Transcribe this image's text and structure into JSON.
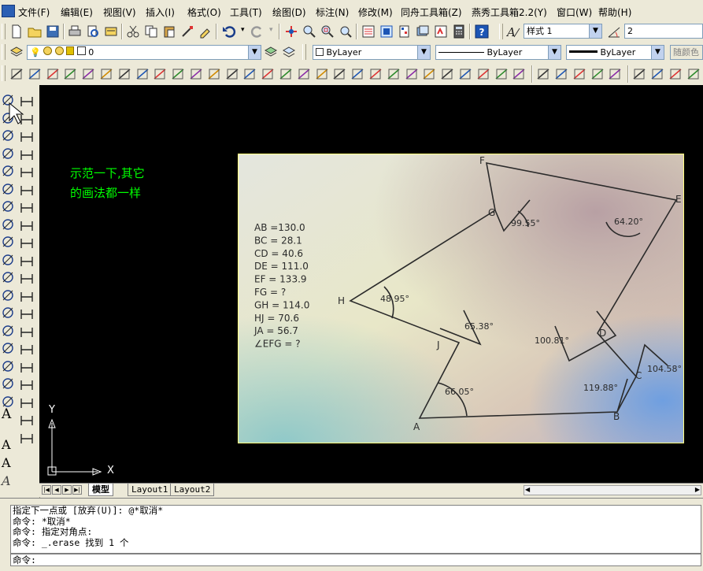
{
  "menubar": {
    "items": [
      "文件(F)",
      "编辑(E)",
      "视图(V)",
      "插入(I)",
      "格式(O)",
      "工具(T)",
      "绘图(D)",
      "标注(N)",
      "修改(M)",
      "同舟工具箱(Z)",
      "燕秀工具箱2.2(Y)",
      "窗口(W)",
      "帮助(H)"
    ]
  },
  "toolbar": {
    "text_style": "样式 1",
    "dim_style": "2"
  },
  "layers": {
    "current_layer": "0",
    "color": "ByLayer",
    "linetype": "ByLayer",
    "lineweight": "ByLayer",
    "plotstyle": "随颜色"
  },
  "annotation": {
    "line1": "示范一下,其它",
    "line2": "的画法都一样"
  },
  "photo": {
    "measurements": [
      "AB =130.0",
      "BC = 28.1",
      "CD = 40.6",
      "DE = 111.0",
      "EF = 133.9",
      "FG = ?",
      "GH = 114.0",
      "HJ = 70.6",
      "JA = 56.7",
      "∠EFG = ?"
    ],
    "points": {
      "A": "A",
      "B": "B",
      "C": "C",
      "D": "D",
      "E": "E",
      "F": "F",
      "G": "G",
      "H": "H",
      "J": "J"
    },
    "angles": {
      "G": "99.55°",
      "E": "64.20°",
      "H": "48.95°",
      "J": "65.38°",
      "D": "100.81°",
      "C": "104.58°",
      "B": "119.88°",
      "A": "66.05°"
    }
  },
  "ucs": {
    "x_label": "X",
    "y_label": "Y"
  },
  "tabs": [
    "模型",
    "Layout1",
    "Layout2"
  ],
  "command": {
    "lines": [
      "指定下一点或 [放弃(U)]: @*取消*",
      "命令: *取消*",
      "命令: 指定对角点:",
      "命令: _.erase 找到 1 个"
    ],
    "prompt": "命令:"
  },
  "colors": {
    "canvas": "#000000",
    "annotation": "#00ff00",
    "frame": "#ffff80"
  }
}
